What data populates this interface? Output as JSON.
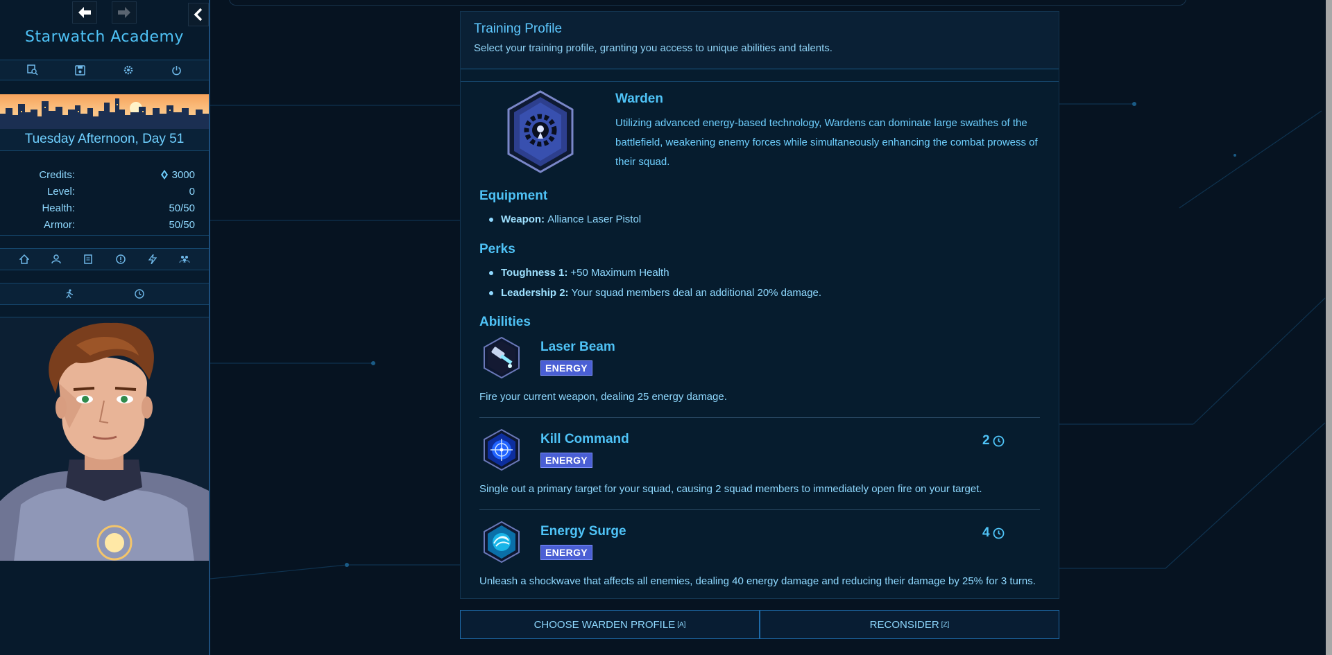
{
  "sidebar": {
    "app_title": "Starwatch Academy",
    "nav": {
      "back_icon": "arrow-left-icon",
      "forward_icon": "arrow-right-icon",
      "collapse_icon": "chevron-left-icon"
    },
    "tools": [
      "search-icon",
      "save-icon",
      "gear-icon",
      "power-icon"
    ],
    "day": "Tuesday Afternoon, Day 51",
    "stats": [
      {
        "label": "Credits:",
        "value": "3000",
        "icon": "credit-gem-icon"
      },
      {
        "label": "Level:",
        "value": "0"
      },
      {
        "label": "Health:",
        "value": "50/50"
      },
      {
        "label": "Armor:",
        "value": "50/50"
      }
    ],
    "menu_icons": [
      "home-icon",
      "person-icon",
      "journal-icon",
      "info-icon",
      "lightning-icon",
      "squad-icon"
    ],
    "action_icons": [
      "run-icon",
      "clock-icon"
    ]
  },
  "panel": {
    "title": "Training Profile",
    "subtitle": "Select your training profile, granting you access to unique abilities and talents.",
    "profile": {
      "name": "Warden",
      "description": "Utilizing advanced energy-based technology, Wardens can dominate large swathes of the battlefield, weakening enemy forces while simultaneously enhancing the combat prowess of their squad."
    },
    "equipment": {
      "heading": "Equipment",
      "items": [
        {
          "label": "Weapon:",
          "value": "Alliance Laser Pistol"
        }
      ]
    },
    "perks": {
      "heading": "Perks",
      "items": [
        {
          "label": "Toughness 1:",
          "value": "+50 Maximum Health"
        },
        {
          "label": "Leadership 2:",
          "value": "Your squad members deal an additional 20% damage."
        }
      ]
    },
    "abilities": {
      "heading": "Abilities",
      "items": [
        {
          "name": "Laser Beam",
          "tag": "ENERGY",
          "cooldown": "",
          "description": "Fire your current weapon, dealing 25 energy damage."
        },
        {
          "name": "Kill Command",
          "tag": "ENERGY",
          "cooldown": "2",
          "description": "Single out a primary target for your squad, causing 2 squad members to immediately open fire on your target."
        },
        {
          "name": "Energy Surge",
          "tag": "ENERGY",
          "cooldown": "4",
          "description": "Unleash a shockwave that affects all enemies, dealing 40 energy damage and reducing their damage by 25% for 3 turns."
        }
      ]
    }
  },
  "buttons": {
    "choose_label": "CHOOSE WARDEN PROFILE",
    "choose_key": "[A]",
    "reconsider_label": "RECONSIDER",
    "reconsider_key": "[Z]"
  },
  "colors": {
    "accent": "#4fc3f7",
    "energy_tag": "#4a5fd4",
    "background": "#061321"
  }
}
